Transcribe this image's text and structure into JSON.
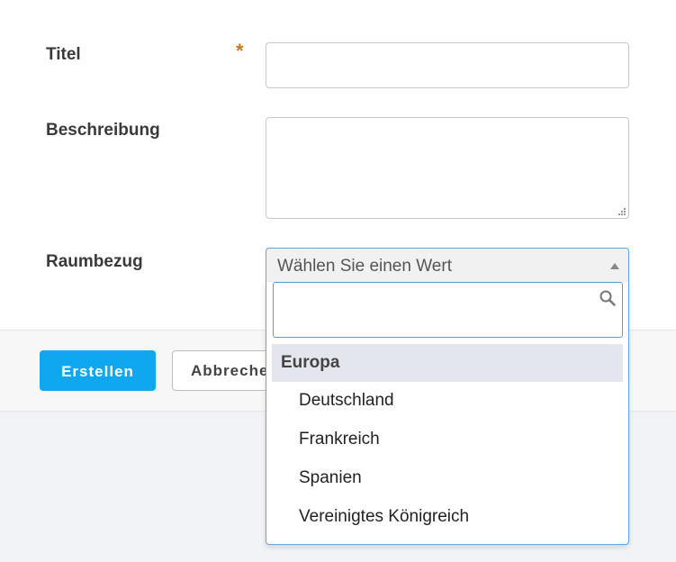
{
  "form": {
    "title_label": "Titel",
    "required_marker": "*",
    "title_value": "",
    "description_label": "Beschreibung",
    "description_value": "",
    "spatial_label": "Raumbezug",
    "spatial_select_value": "Wählen Sie einen Wert"
  },
  "dropdown": {
    "search_value": "",
    "group_label": "Europa",
    "options": [
      "Deutschland",
      "Frankreich",
      "Spanien",
      "Vereinigtes Königreich"
    ]
  },
  "actions": {
    "create_label": "Erstellen",
    "cancel_label": "Abbrechen"
  },
  "colors": {
    "primary_button": "#0fa8f0",
    "required_marker": "#c9781c",
    "focus_border": "#5aa6e6",
    "group_header_bg": "#e3e6ec"
  },
  "icons": {
    "search": "search-icon",
    "select_arrow": "triangle-up-icon",
    "resize": "resize-grip-icon"
  }
}
